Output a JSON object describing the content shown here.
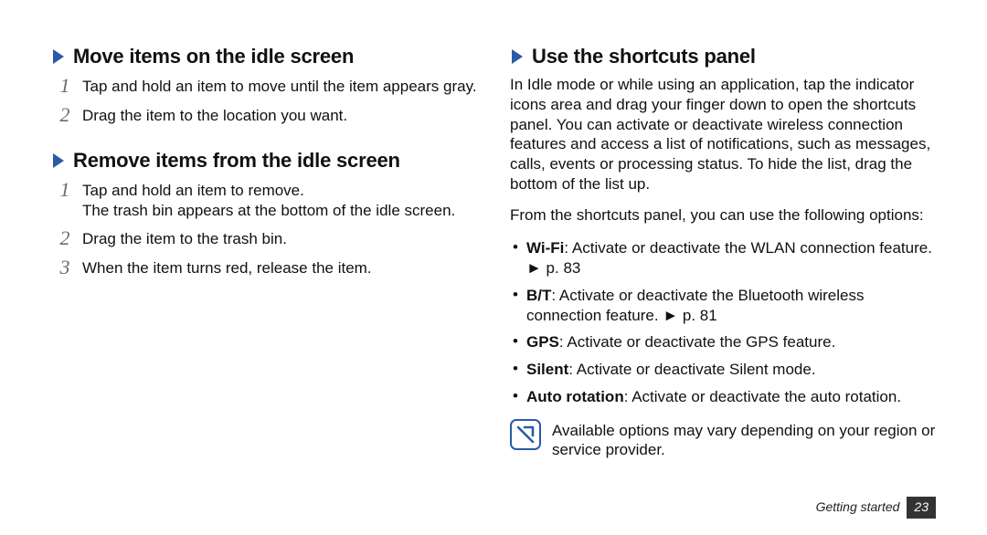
{
  "left": {
    "sections": [
      {
        "title": "Move items on the idle screen",
        "steps": [
          "Tap and hold an item to move until the item appears gray.",
          "Drag the item to the location you want."
        ]
      },
      {
        "title": "Remove items from the idle screen",
        "steps": [
          "Tap and hold an item to remove.\nThe trash bin appears at the bottom of the idle screen.",
          "Drag the item to the trash bin.",
          "When the item turns red, release the item."
        ]
      }
    ]
  },
  "right": {
    "section": {
      "title": "Use the shortcuts panel",
      "intro": "In Idle mode or while using an application, tap the indicator icons area and drag your finger down to open the shortcuts panel. You can activate or deactivate wireless connection features and access a list of notifications, such as messages, calls, events or processing status. To hide the list, drag the bottom of the list up.",
      "lead": "From the shortcuts panel, you can use the following options:",
      "bullets": [
        {
          "bold": "Wi-Fi",
          "text": ": Activate or deactivate the WLAN connection feature. ► p. 83"
        },
        {
          "bold": "B/T",
          "text": ": Activate or deactivate the Bluetooth wireless connection feature. ► p. 81"
        },
        {
          "bold": "GPS",
          "text": ": Activate or deactivate the GPS feature."
        },
        {
          "bold": "Silent",
          "text": ": Activate or deactivate Silent mode."
        },
        {
          "bold": "Auto rotation",
          "text": ": Activate or deactivate the auto rotation."
        }
      ],
      "note": "Available options may vary depending on your region or service provider."
    }
  },
  "footer": {
    "section_label": "Getting started",
    "page_number": "23"
  }
}
